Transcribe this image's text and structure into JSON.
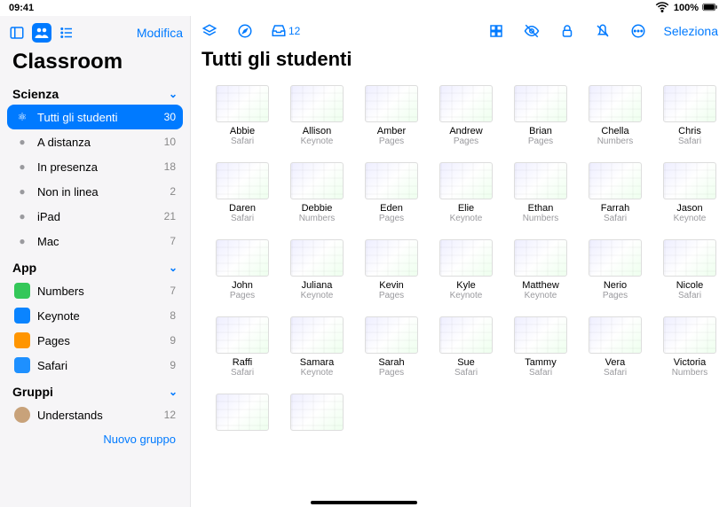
{
  "status": {
    "time": "09:41",
    "battery": "100%"
  },
  "sidebar": {
    "edit": "Modifica",
    "app_title": "Classroom",
    "sections": [
      {
        "title": "Scienza",
        "items": [
          {
            "label": "Tutti gli studenti",
            "count": "30",
            "selected": true,
            "icon": "atom",
            "icon_color": "#fff"
          },
          {
            "label": "A distanza",
            "count": "10",
            "icon": "dot",
            "icon_color": "#9a9a9e"
          },
          {
            "label": "In presenza",
            "count": "18",
            "icon": "dot",
            "icon_color": "#9a9a9e"
          },
          {
            "label": "Non in linea",
            "count": "2",
            "icon": "dot",
            "icon_color": "#9a9a9e"
          },
          {
            "label": "iPad",
            "count": "21",
            "icon": "dot",
            "icon_color": "#9a9a9e"
          },
          {
            "label": "Mac",
            "count": "7",
            "icon": "dot",
            "icon_color": "#9a9a9e"
          }
        ]
      },
      {
        "title": "App",
        "items": [
          {
            "label": "Numbers",
            "count": "7",
            "icon": "app",
            "icon_bg": "#34c759"
          },
          {
            "label": "Keynote",
            "count": "8",
            "icon": "app",
            "icon_bg": "#0a84ff"
          },
          {
            "label": "Pages",
            "count": "9",
            "icon": "app",
            "icon_bg": "#ff9500"
          },
          {
            "label": "Safari",
            "count": "9",
            "icon": "app",
            "icon_bg": "#1e90ff"
          }
        ]
      },
      {
        "title": "Gruppi",
        "items": [
          {
            "label": "Understands",
            "count": "12",
            "icon": "avatar",
            "icon_bg": "#c8a27a"
          }
        ]
      }
    ],
    "new_group": "Nuovo gruppo"
  },
  "main": {
    "title": "Tutti gli studenti",
    "inbox_count": "12",
    "select": "Seleziona",
    "students": [
      {
        "name": "Abbie",
        "app": "Safari"
      },
      {
        "name": "Allison",
        "app": "Keynote"
      },
      {
        "name": "Amber",
        "app": "Pages"
      },
      {
        "name": "Andrew",
        "app": "Pages"
      },
      {
        "name": "Brian",
        "app": "Pages"
      },
      {
        "name": "Chella",
        "app": "Numbers"
      },
      {
        "name": "Chris",
        "app": "Safari"
      },
      {
        "name": "Daren",
        "app": "Safari"
      },
      {
        "name": "Debbie",
        "app": "Numbers"
      },
      {
        "name": "Eden",
        "app": "Pages"
      },
      {
        "name": "Elie",
        "app": "Keynote"
      },
      {
        "name": "Ethan",
        "app": "Numbers"
      },
      {
        "name": "Farrah",
        "app": "Safari"
      },
      {
        "name": "Jason",
        "app": "Keynote"
      },
      {
        "name": "John",
        "app": "Pages"
      },
      {
        "name": "Juliana",
        "app": "Keynote"
      },
      {
        "name": "Kevin",
        "app": "Pages"
      },
      {
        "name": "Kyle",
        "app": "Keynote"
      },
      {
        "name": "Matthew",
        "app": "Keynote"
      },
      {
        "name": "Nerio",
        "app": "Pages"
      },
      {
        "name": "Nicole",
        "app": "Safari"
      },
      {
        "name": "Raffi",
        "app": "Safari"
      },
      {
        "name": "Samara",
        "app": "Keynote"
      },
      {
        "name": "Sarah",
        "app": "Pages"
      },
      {
        "name": "Sue",
        "app": "Safari"
      },
      {
        "name": "Tammy",
        "app": "Safari"
      },
      {
        "name": "Vera",
        "app": "Safari"
      },
      {
        "name": "Victoria",
        "app": "Numbers"
      },
      {
        "name": "",
        "app": ""
      },
      {
        "name": "",
        "app": ""
      }
    ]
  }
}
